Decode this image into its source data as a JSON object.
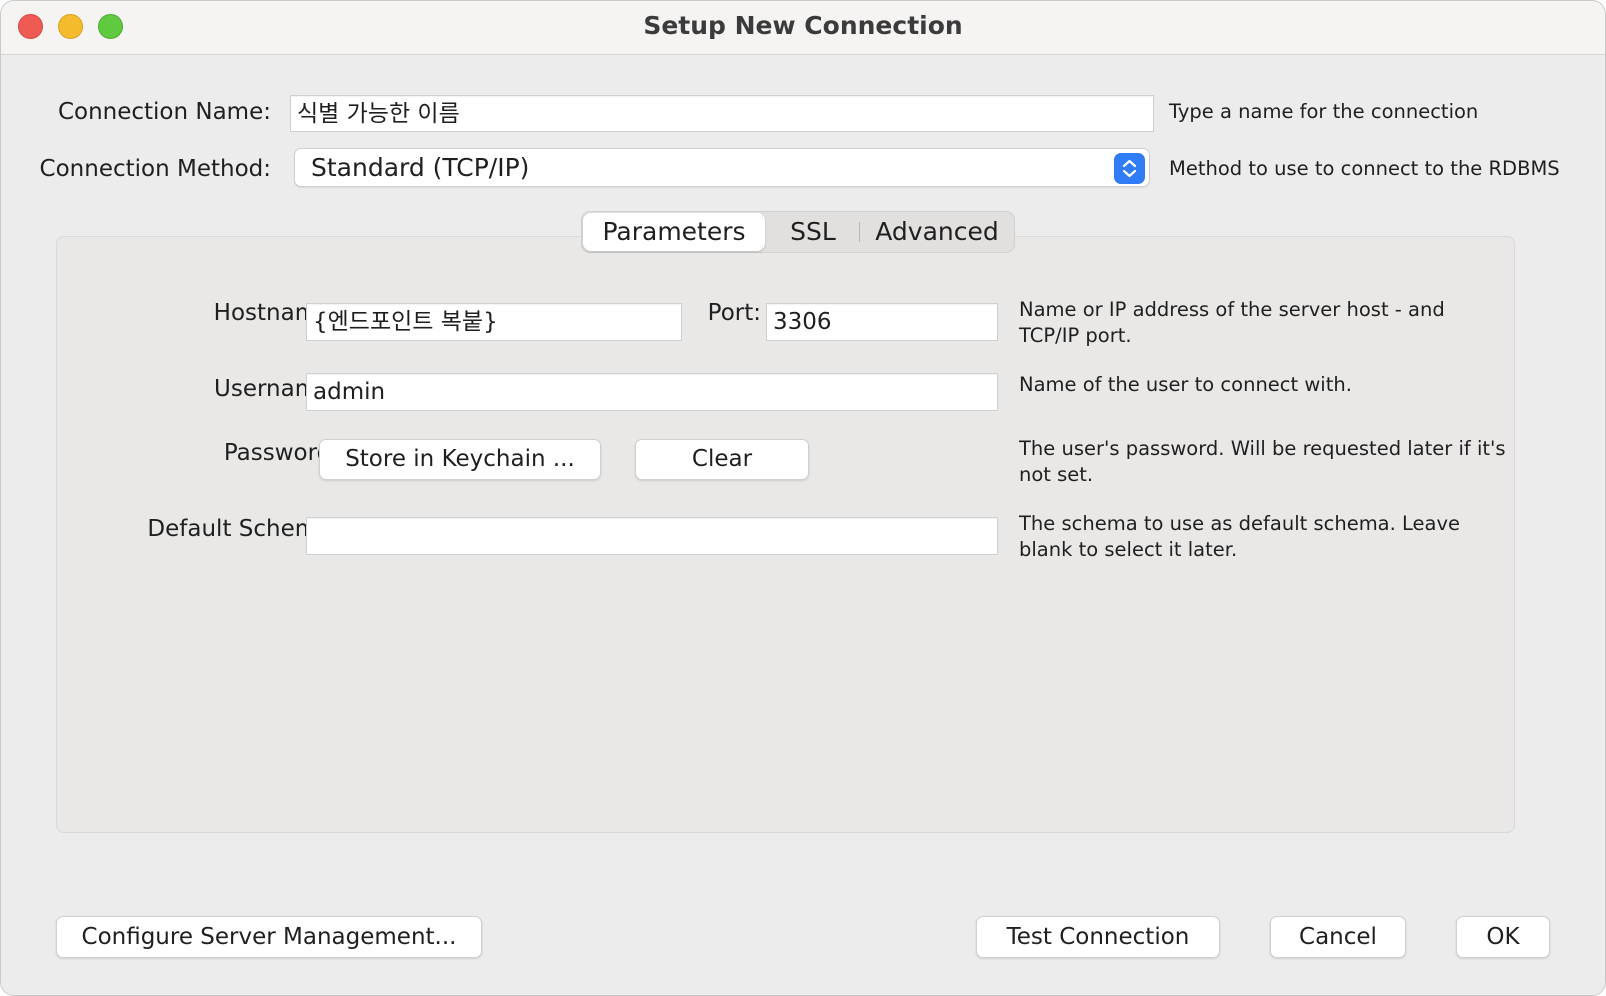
{
  "window": {
    "title": "Setup New Connection"
  },
  "connection_name": {
    "label": "Connection Name:",
    "value": "식별 가능한 이름",
    "help": "Type a name for the connection"
  },
  "connection_method": {
    "label": "Connection Method:",
    "selected": "Standard (TCP/IP)",
    "help": "Method to use to connect to the RDBMS"
  },
  "tabs": [
    {
      "label": "Parameters",
      "active": true
    },
    {
      "label": "SSL",
      "active": false
    },
    {
      "label": "Advanced",
      "active": false
    }
  ],
  "parameters": {
    "hostname": {
      "label": "Hostname:",
      "value": "{엔드포인트 복붙}"
    },
    "port": {
      "label": "Port:",
      "value": "3306"
    },
    "hostname_help": "Name or IP address of the server host - and TCP/IP port.",
    "username": {
      "label": "Username:",
      "value": "admin",
      "help": "Name of the user to connect with."
    },
    "password": {
      "label": "Password:",
      "store_button": "Store in Keychain ...",
      "clear_button": "Clear",
      "help": "The user's password. Will be requested later if it's not set."
    },
    "default_schema": {
      "label": "Default Schema:",
      "value": "",
      "help": "The schema to use as default schema. Leave blank to select it later."
    }
  },
  "footer": {
    "configure_button": "Configure Server Management...",
    "test_button": "Test Connection",
    "cancel_button": "Cancel",
    "ok_button": "OK"
  },
  "colors": {
    "accent": "#2f7cf6",
    "close": "#ee5b55",
    "minimize": "#f4bb2c",
    "maximize": "#5fc93f"
  }
}
